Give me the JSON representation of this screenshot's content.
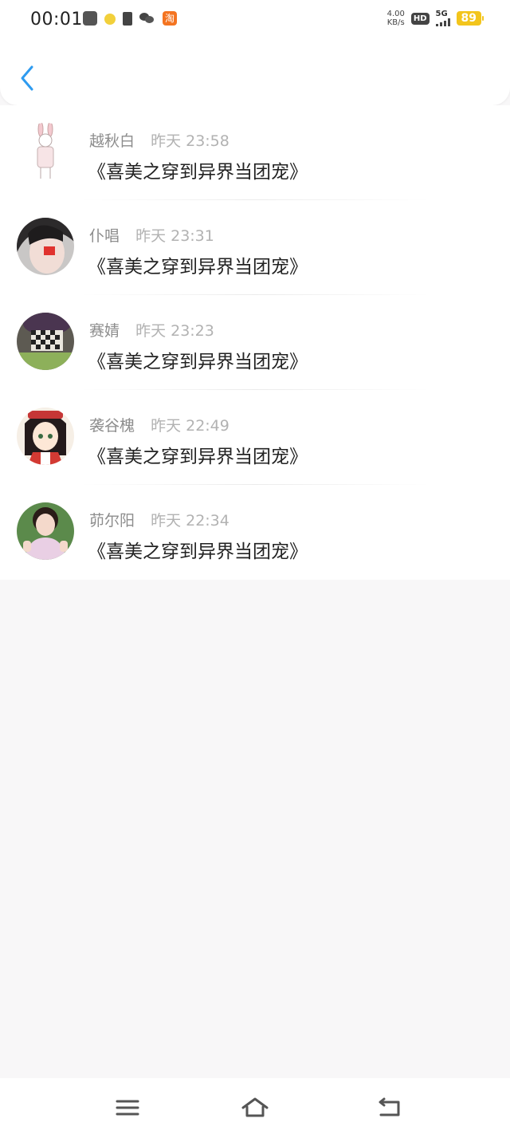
{
  "status_bar": {
    "time": "00:01",
    "net_speed_value": "4.00",
    "net_speed_unit": "KB/s",
    "hd": "HD",
    "network": "5G",
    "battery": "89",
    "icons": [
      "app-icon",
      "smiley-icon",
      "battery-saver-icon",
      "wechat-icon",
      "taobao-icon"
    ],
    "taobao_label": "淘"
  },
  "header": {
    "back_icon": "chevron-left-icon",
    "accent": "#2e9bf0"
  },
  "comments": [
    {
      "name": "越秋白",
      "time": "昨天 23:58",
      "content": "《喜美之穿到异界当团宠》"
    },
    {
      "name": "仆唱",
      "time": "昨天 23:31",
      "content": "《喜美之穿到异界当团宠》"
    },
    {
      "name": "赛婧",
      "time": "昨天 23:23",
      "content": "《喜美之穿到异界当团宠》"
    },
    {
      "name": "袭谷槐",
      "time": "昨天 22:49",
      "content": "《喜美之穿到异界当团宠》"
    },
    {
      "name": "茆尔阳",
      "time": "昨天 22:34",
      "content": "《喜美之穿到异界当团宠》"
    }
  ],
  "nav": {
    "icons": [
      "menu-icon",
      "home-icon",
      "back-icon"
    ]
  }
}
